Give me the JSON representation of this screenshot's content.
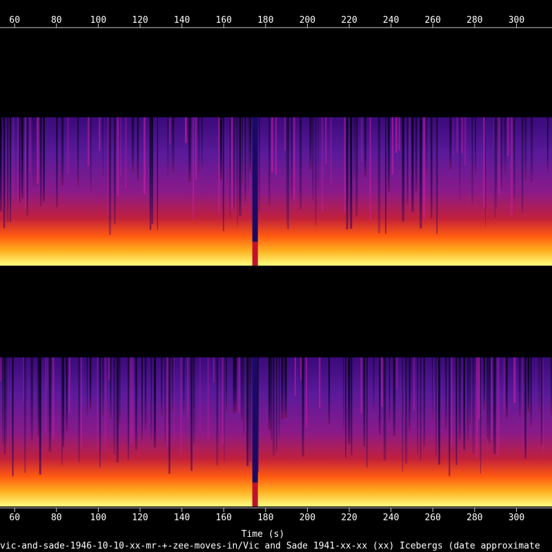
{
  "chart_data": {
    "type": "heatmap",
    "title": "",
    "xlabel": "Time (s)",
    "ylabel": "",
    "file_label": "vic-and-sade-1946-10-10-xx-mr-+-zee-moves-in/Vic and Sade 1941-xx-xx (xx) Icebergs (date approximate",
    "x_ticks": [
      60,
      80,
      100,
      120,
      140,
      160,
      180,
      200,
      220,
      240,
      260,
      280,
      300
    ],
    "xlim": [
      53,
      317
    ],
    "channels": [
      {
        "name": "",
        "band_top_fraction": 0.62,
        "dropout_at_s": 175
      },
      {
        "name": "",
        "band_top_fraction": 0.62,
        "dropout_at_s": 175
      }
    ],
    "colormap": [
      "#000000",
      "#1e0a5a",
      "#5a1a9a",
      "#9a1a8a",
      "#d8203a",
      "#ff6010",
      "#ffb020",
      "#ffff90"
    ],
    "grid": false
  }
}
